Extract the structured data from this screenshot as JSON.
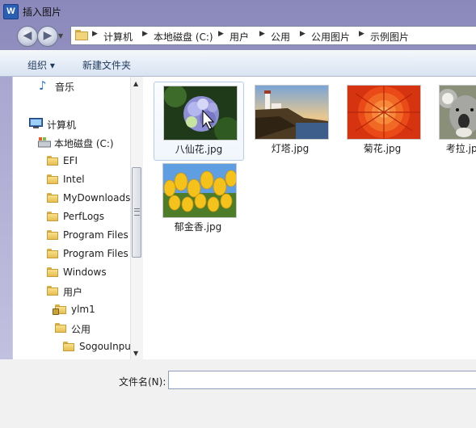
{
  "window": {
    "title": "插入图片",
    "app_icon_letter": "W"
  },
  "address": {
    "crumbs": [
      "计算机",
      "本地磁盘 (C:)",
      "用户",
      "公用",
      "公用图片",
      "示例图片"
    ]
  },
  "toolbar": {
    "organize": "组织 ▾",
    "new_folder": "新建文件夹"
  },
  "sidebar": {
    "items": [
      {
        "label": "音乐",
        "icon": "music-icon"
      },
      {
        "label": "计算机",
        "icon": "computer-icon"
      },
      {
        "label": "本地磁盘 (C:)",
        "icon": "drive-icon"
      },
      {
        "label": "EFI",
        "icon": "folder-icon"
      },
      {
        "label": "Intel",
        "icon": "folder-icon"
      },
      {
        "label": "MyDownloads",
        "icon": "folder-icon"
      },
      {
        "label": "PerfLogs",
        "icon": "folder-icon"
      },
      {
        "label": "Program Files",
        "icon": "folder-icon"
      },
      {
        "label": "Program Files",
        "icon": "folder-icon"
      },
      {
        "label": "Windows",
        "icon": "folder-icon"
      },
      {
        "label": "用户",
        "icon": "folder-icon"
      },
      {
        "label": "ylm1",
        "icon": "locked-folder-icon"
      },
      {
        "label": "公用",
        "icon": "folder-icon"
      },
      {
        "label": "SogouInput",
        "icon": "folder-icon"
      }
    ]
  },
  "files": [
    {
      "name": "八仙花.jpg",
      "selected": true
    },
    {
      "name": "灯塔.jpg",
      "selected": false
    },
    {
      "name": "菊花.jpg",
      "selected": false
    },
    {
      "name": "考拉.jpg",
      "selected": false
    },
    {
      "name": "郁金香.jpg",
      "selected": false
    }
  ],
  "filename": {
    "label": "文件名(N):",
    "value": ""
  },
  "colors": {
    "window_frame": "#9c99c8",
    "toolbar_text": "#1e395b",
    "selection_border": "#b5cde9"
  }
}
